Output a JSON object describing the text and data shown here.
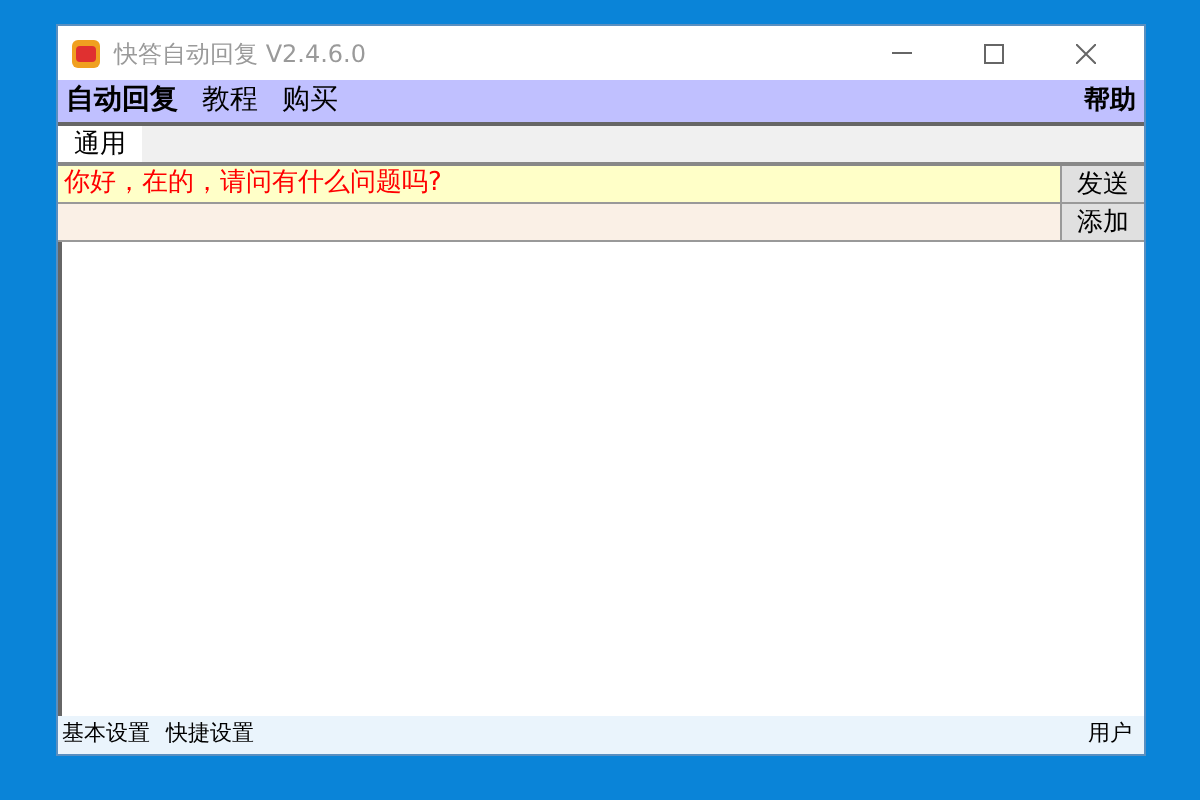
{
  "window": {
    "title": "快答自动回复 V2.4.6.0"
  },
  "menu": {
    "items": [
      "自动回复",
      "教程",
      "购买"
    ],
    "help": "帮助"
  },
  "tabs": [
    {
      "label": "通用",
      "selected": true
    }
  ],
  "rows": [
    {
      "value": "你好，在的，请问有什么问题吗?",
      "button": "发送",
      "kind": "message"
    },
    {
      "value": "",
      "button": "添加",
      "kind": "blank"
    }
  ],
  "status_bar": {
    "left": [
      "基本设置",
      "快捷设置"
    ],
    "right": "用户"
  }
}
